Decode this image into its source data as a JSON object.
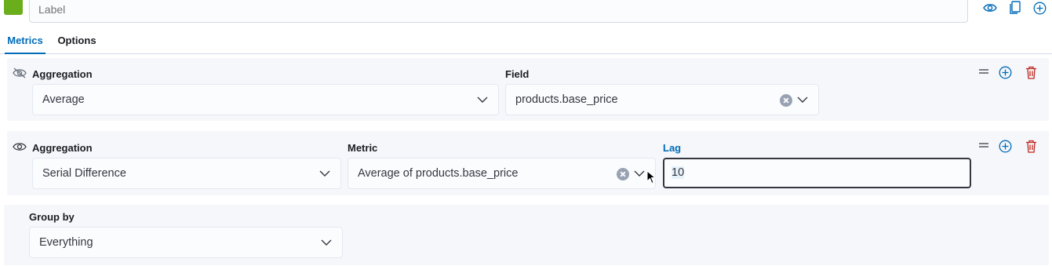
{
  "series": {
    "color": "#6bae1c",
    "label_placeholder": "Label"
  },
  "tabs": [
    {
      "label": "Metrics",
      "active": true
    },
    {
      "label": "Options",
      "active": false
    }
  ],
  "metrics": [
    {
      "visibility": "hidden",
      "aggregation_label": "Aggregation",
      "aggregation_value": "Average",
      "field_label": "Field",
      "field_value": "products.base_price"
    },
    {
      "visibility": "visible",
      "aggregation_label": "Aggregation",
      "aggregation_value": "Serial Difference",
      "metric_label": "Metric",
      "metric_value": "Average of products.base_price",
      "lag_label": "Lag",
      "lag_value": "10"
    }
  ],
  "group_by": {
    "label": "Group by",
    "value": "Everything"
  },
  "colors": {
    "accent": "#006bb8",
    "delete": "#bd271e",
    "panel": "#f5f7fa"
  }
}
